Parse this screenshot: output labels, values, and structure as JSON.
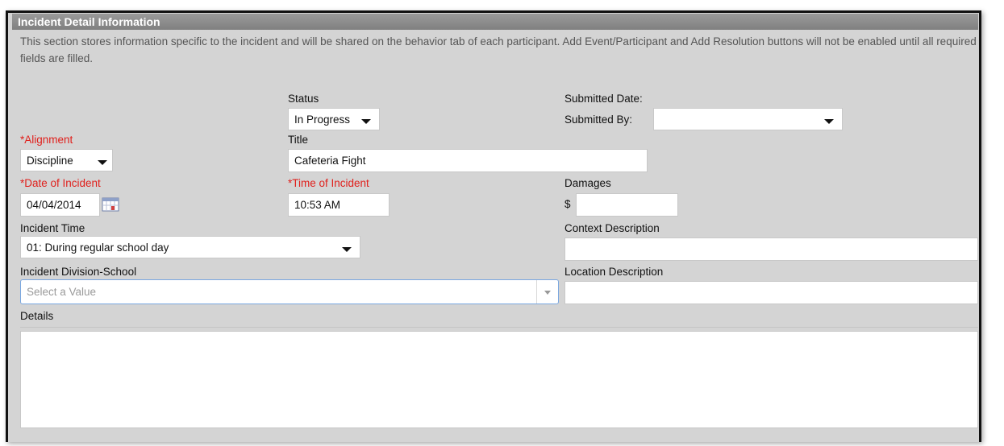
{
  "section": {
    "title": "Incident Detail Information",
    "description": "This section stores information specific to the incident and will be shared on the behavior tab of each participant. Add Event/Participant and Add Resolution buttons will not be enabled until all required fields are filled."
  },
  "status": {
    "label": "Status",
    "value": "In Progress"
  },
  "submitted_date": {
    "label": "Submitted Date:"
  },
  "submitted_by": {
    "label": "Submitted By:",
    "value": ""
  },
  "alignment": {
    "label": "*Alignment",
    "value": "Discipline"
  },
  "title_field": {
    "label": "Title",
    "value": "Cafeteria Fight"
  },
  "date_of_incident": {
    "label": "*Date of Incident",
    "value": "04/04/2014"
  },
  "time_of_incident": {
    "label": "*Time of Incident",
    "value": "10:53 AM"
  },
  "damages": {
    "label": "Damages",
    "currency": "$",
    "value": ""
  },
  "incident_time": {
    "label": "Incident Time",
    "value": "01: During regular school day"
  },
  "context_description": {
    "label": "Context Description",
    "value": ""
  },
  "incident_division": {
    "label": "Incident Division-School",
    "placeholder": "Select a Value"
  },
  "location_description": {
    "label": "Location Description",
    "value": ""
  },
  "details": {
    "label": "Details",
    "value": ""
  },
  "colors": {
    "required": "#e0201c",
    "header_bg": "#8c8c8c",
    "panel_bg": "#d4d4d4"
  }
}
